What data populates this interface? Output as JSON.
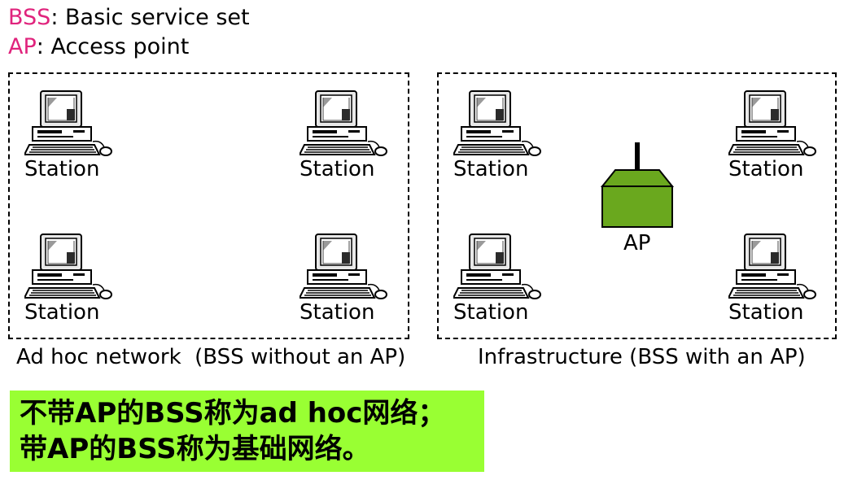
{
  "legend": {
    "bss": {
      "abbr": "BSS",
      "text": ": Basic service set"
    },
    "ap": {
      "abbr": "AP",
      "text": ": Access point"
    }
  },
  "adhoc": {
    "caption": "Ad hoc network  (BSS without an AP)",
    "stations": [
      "Station",
      "Station",
      "Station",
      "Station"
    ]
  },
  "infrastructure": {
    "caption": "Infrastructure (BSS with an AP)",
    "stations": [
      "Station",
      "Station",
      "Station",
      "Station"
    ],
    "ap_label": "AP"
  },
  "note": {
    "line1": "不带AP的BSS称为ad hoc网络；",
    "line2": "带AP的BSS称为基础网络。"
  },
  "colors": {
    "abbr": "#e0247d",
    "ap_box": "#6aa81e",
    "note_bg": "#99ff33"
  }
}
